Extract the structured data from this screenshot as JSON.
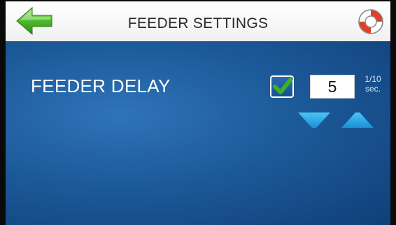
{
  "header": {
    "title": "FEEDER SETTINGS",
    "back_icon": "back-arrow-icon",
    "help_icon": "lifebuoy-icon"
  },
  "setting": {
    "label": "FEEDER DELAY",
    "enabled": true,
    "value": "5",
    "unit_line1": "1/10",
    "unit_line2": "sec."
  },
  "controls": {
    "decrease_icon": "down-triangle-icon",
    "increase_icon": "up-triangle-icon"
  },
  "colors": {
    "panel_blue": "#1d5a9a",
    "accent_green": "#3fae2a",
    "arrow_cyan": "#2aa7e6"
  }
}
